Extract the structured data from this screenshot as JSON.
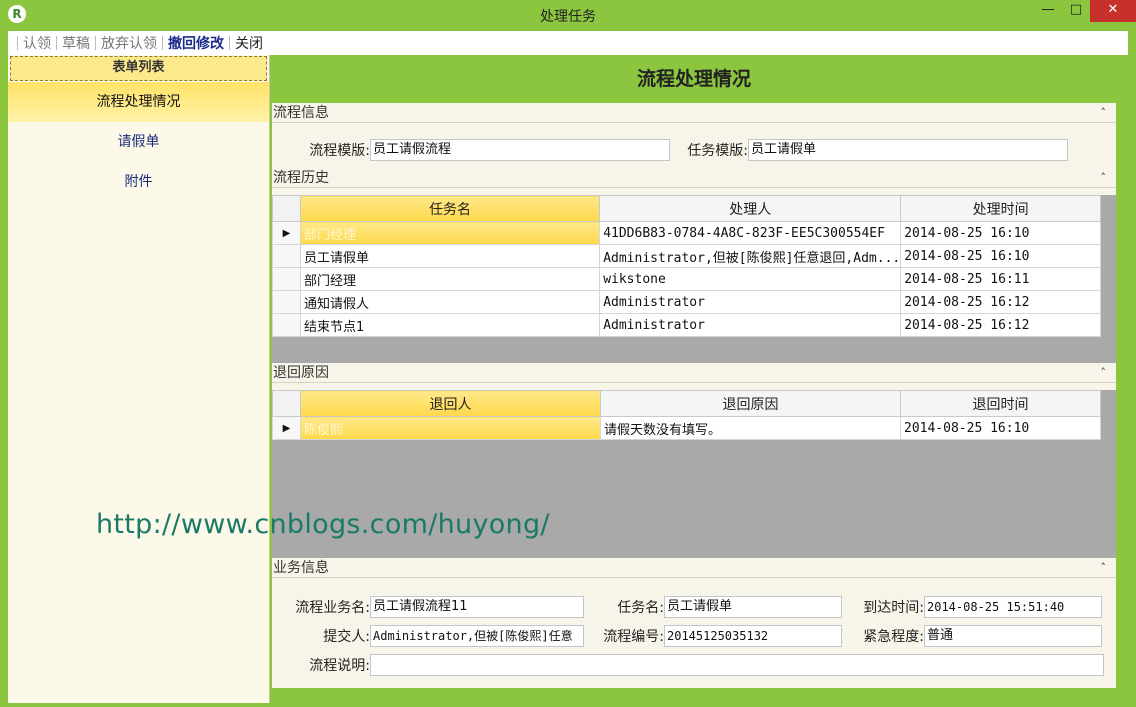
{
  "window": {
    "title": "处理任务",
    "icon_letter": "R",
    "min_glyph": "—",
    "max_glyph": "□",
    "close_glyph": "✕"
  },
  "toolbar": {
    "items": [
      {
        "label": "认领",
        "state": "disabled"
      },
      {
        "label": "草稿",
        "state": "disabled"
      },
      {
        "label": "放弃认领",
        "state": "disabled"
      },
      {
        "label": "撤回修改",
        "state": "active"
      },
      {
        "label": "关闭",
        "state": "normal"
      }
    ]
  },
  "sidebar": {
    "header": "表单列表",
    "items": [
      {
        "label": "流程处理情况",
        "active": true
      },
      {
        "label": "请假单",
        "active": false
      },
      {
        "label": "附件",
        "active": false
      }
    ]
  },
  "main": {
    "title": "流程处理情况",
    "flow_info": {
      "section_label": "流程信息",
      "template_label": "流程模版:",
      "template_value": "员工请假流程",
      "task_template_label": "任务模版:",
      "task_template_value": "员工请假单"
    },
    "history": {
      "section_label": "流程历史",
      "columns": [
        "任务名",
        "处理人",
        "处理时间"
      ],
      "rows": [
        [
          "部门经理",
          "41DD6B83-0784-4A8C-823F-EE5C300554EF",
          "2014-08-25 16:10"
        ],
        [
          "员工请假单",
          "Administrator,但被[陈俊熙]任意退回,Adm...",
          "2014-08-25 16:10"
        ],
        [
          "部门经理",
          "wikstone",
          "2014-08-25 16:11"
        ],
        [
          "通知请假人",
          "Administrator",
          "2014-08-25 16:12"
        ],
        [
          "结束节点1",
          "Administrator",
          "2014-08-25 16:12"
        ]
      ]
    },
    "returns": {
      "section_label": "退回原因",
      "columns": [
        "退回人",
        "退回原因",
        "退回时间"
      ],
      "rows": [
        [
          "陈俊熙",
          "请假天数没有填写。",
          "2014-08-25 16:10"
        ]
      ]
    },
    "business": {
      "section_label": "业务信息",
      "fields": {
        "flow_name_label": "流程业务名:",
        "flow_name_value": "员工请假流程11",
        "task_name_label": "任务名:",
        "task_name_value": "员工请假单",
        "arrival_label": "到达时间:",
        "arrival_value": "2014-08-25 15:51:40",
        "submitter_label": "提交人:",
        "submitter_value": "Administrator,但被[陈俊熙]任意",
        "flow_no_label": "流程编号:",
        "flow_no_value": "20145125035132",
        "urgency_label": "紧急程度:",
        "urgency_value": "普通",
        "desc_label": "流程说明:",
        "desc_value": ""
      }
    }
  },
  "watermark": "http://www.cnblogs.com/huyong/",
  "icons": {
    "collapse": "collapse-chevron-icon",
    "row_pointer": "row-pointer-icon"
  }
}
